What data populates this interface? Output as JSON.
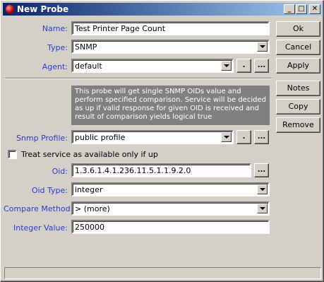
{
  "window": {
    "title": "New Probe",
    "controls": {
      "minimize": "_",
      "maximize": "□",
      "close": "✕"
    }
  },
  "form": {
    "name": {
      "label": "Name:",
      "value": "Test Printer Page Count"
    },
    "type": {
      "label": "Type:",
      "value": "SNMP"
    },
    "agent": {
      "label": "Agent:",
      "value": "default"
    },
    "info_text": "This probe will get single SNMP OIDs value and perform specified comparison. Service will be decided as up if valid response for given OID is received and result of comparison yields logical true",
    "snmp_profile": {
      "label": "Snmp Profile:",
      "value": "public profile"
    },
    "treat_service": {
      "label": "Treat service as available only if up",
      "checked": false
    },
    "oid": {
      "label": "Oid:",
      "value": "1.3.6.1.4.1.236.11.5.1.1.9.2.0"
    },
    "oid_type": {
      "label": "Oid Type:",
      "value": "integer"
    },
    "compare_method": {
      "label": "Compare Method:",
      "value": "> (more)"
    },
    "integer_value": {
      "label": "Integer Value:",
      "value": "250000"
    }
  },
  "small_buttons": {
    "add": ".",
    "browse": "..."
  },
  "buttons": {
    "ok": "Ok",
    "cancel": "Cancel",
    "apply": "Apply",
    "notes": "Notes",
    "copy": "Copy",
    "remove": "Remove"
  },
  "colors": {
    "label": "#2a3cd0",
    "titlebar_start": "#0a246a",
    "titlebar_end": "#a6caf0",
    "info_bg": "#808080"
  }
}
